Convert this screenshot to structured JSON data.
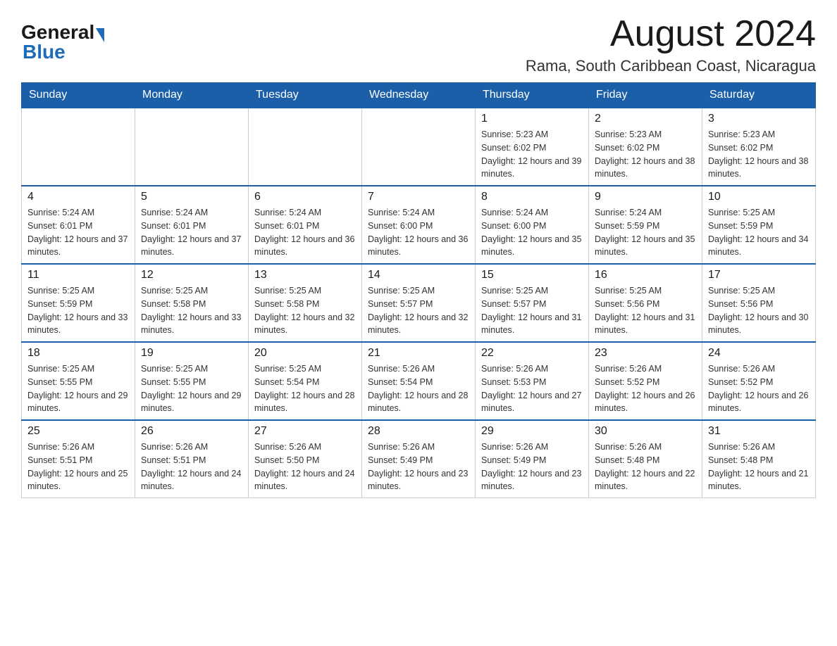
{
  "header": {
    "logo_general": "General",
    "logo_blue": "Blue",
    "month_title": "August 2024",
    "location": "Rama, South Caribbean Coast, Nicaragua"
  },
  "weekdays": [
    "Sunday",
    "Monday",
    "Tuesday",
    "Wednesday",
    "Thursday",
    "Friday",
    "Saturday"
  ],
  "weeks": [
    [
      {
        "day": "",
        "info": ""
      },
      {
        "day": "",
        "info": ""
      },
      {
        "day": "",
        "info": ""
      },
      {
        "day": "",
        "info": ""
      },
      {
        "day": "1",
        "info": "Sunrise: 5:23 AM\nSunset: 6:02 PM\nDaylight: 12 hours and 39 minutes."
      },
      {
        "day": "2",
        "info": "Sunrise: 5:23 AM\nSunset: 6:02 PM\nDaylight: 12 hours and 38 minutes."
      },
      {
        "day": "3",
        "info": "Sunrise: 5:23 AM\nSunset: 6:02 PM\nDaylight: 12 hours and 38 minutes."
      }
    ],
    [
      {
        "day": "4",
        "info": "Sunrise: 5:24 AM\nSunset: 6:01 PM\nDaylight: 12 hours and 37 minutes."
      },
      {
        "day": "5",
        "info": "Sunrise: 5:24 AM\nSunset: 6:01 PM\nDaylight: 12 hours and 37 minutes."
      },
      {
        "day": "6",
        "info": "Sunrise: 5:24 AM\nSunset: 6:01 PM\nDaylight: 12 hours and 36 minutes."
      },
      {
        "day": "7",
        "info": "Sunrise: 5:24 AM\nSunset: 6:00 PM\nDaylight: 12 hours and 36 minutes."
      },
      {
        "day": "8",
        "info": "Sunrise: 5:24 AM\nSunset: 6:00 PM\nDaylight: 12 hours and 35 minutes."
      },
      {
        "day": "9",
        "info": "Sunrise: 5:24 AM\nSunset: 5:59 PM\nDaylight: 12 hours and 35 minutes."
      },
      {
        "day": "10",
        "info": "Sunrise: 5:25 AM\nSunset: 5:59 PM\nDaylight: 12 hours and 34 minutes."
      }
    ],
    [
      {
        "day": "11",
        "info": "Sunrise: 5:25 AM\nSunset: 5:59 PM\nDaylight: 12 hours and 33 minutes."
      },
      {
        "day": "12",
        "info": "Sunrise: 5:25 AM\nSunset: 5:58 PM\nDaylight: 12 hours and 33 minutes."
      },
      {
        "day": "13",
        "info": "Sunrise: 5:25 AM\nSunset: 5:58 PM\nDaylight: 12 hours and 32 minutes."
      },
      {
        "day": "14",
        "info": "Sunrise: 5:25 AM\nSunset: 5:57 PM\nDaylight: 12 hours and 32 minutes."
      },
      {
        "day": "15",
        "info": "Sunrise: 5:25 AM\nSunset: 5:57 PM\nDaylight: 12 hours and 31 minutes."
      },
      {
        "day": "16",
        "info": "Sunrise: 5:25 AM\nSunset: 5:56 PM\nDaylight: 12 hours and 31 minutes."
      },
      {
        "day": "17",
        "info": "Sunrise: 5:25 AM\nSunset: 5:56 PM\nDaylight: 12 hours and 30 minutes."
      }
    ],
    [
      {
        "day": "18",
        "info": "Sunrise: 5:25 AM\nSunset: 5:55 PM\nDaylight: 12 hours and 29 minutes."
      },
      {
        "day": "19",
        "info": "Sunrise: 5:25 AM\nSunset: 5:55 PM\nDaylight: 12 hours and 29 minutes."
      },
      {
        "day": "20",
        "info": "Sunrise: 5:25 AM\nSunset: 5:54 PM\nDaylight: 12 hours and 28 minutes."
      },
      {
        "day": "21",
        "info": "Sunrise: 5:26 AM\nSunset: 5:54 PM\nDaylight: 12 hours and 28 minutes."
      },
      {
        "day": "22",
        "info": "Sunrise: 5:26 AM\nSunset: 5:53 PM\nDaylight: 12 hours and 27 minutes."
      },
      {
        "day": "23",
        "info": "Sunrise: 5:26 AM\nSunset: 5:52 PM\nDaylight: 12 hours and 26 minutes."
      },
      {
        "day": "24",
        "info": "Sunrise: 5:26 AM\nSunset: 5:52 PM\nDaylight: 12 hours and 26 minutes."
      }
    ],
    [
      {
        "day": "25",
        "info": "Sunrise: 5:26 AM\nSunset: 5:51 PM\nDaylight: 12 hours and 25 minutes."
      },
      {
        "day": "26",
        "info": "Sunrise: 5:26 AM\nSunset: 5:51 PM\nDaylight: 12 hours and 24 minutes."
      },
      {
        "day": "27",
        "info": "Sunrise: 5:26 AM\nSunset: 5:50 PM\nDaylight: 12 hours and 24 minutes."
      },
      {
        "day": "28",
        "info": "Sunrise: 5:26 AM\nSunset: 5:49 PM\nDaylight: 12 hours and 23 minutes."
      },
      {
        "day": "29",
        "info": "Sunrise: 5:26 AM\nSunset: 5:49 PM\nDaylight: 12 hours and 23 minutes."
      },
      {
        "day": "30",
        "info": "Sunrise: 5:26 AM\nSunset: 5:48 PM\nDaylight: 12 hours and 22 minutes."
      },
      {
        "day": "31",
        "info": "Sunrise: 5:26 AM\nSunset: 5:48 PM\nDaylight: 12 hours and 21 minutes."
      }
    ]
  ]
}
